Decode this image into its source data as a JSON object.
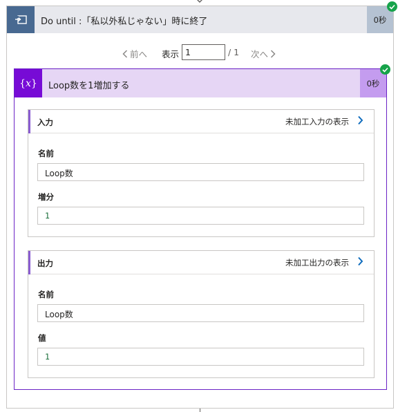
{
  "loop": {
    "title": "Do until :「私以外私じゃない」時に終了",
    "duration": "0秒",
    "icon": "loop-icon",
    "status": "success-check-icon"
  },
  "pager": {
    "prev_label": "前へ",
    "show_label": "表示",
    "page_value": "1",
    "total": "/ 1",
    "next_label": "次へ"
  },
  "action": {
    "title": "Loop数を1増加する",
    "duration": "0秒",
    "icon_text": "{𝑥}",
    "status": "success-check-icon"
  },
  "inputs": {
    "title": "入力",
    "raw_link": "未加工入力の表示",
    "fields": [
      {
        "label": "名前",
        "value": "Loop数"
      },
      {
        "label": "増分",
        "value": "1"
      }
    ]
  },
  "outputs": {
    "title": "出力",
    "raw_link": "未加工出力の表示",
    "fields": [
      {
        "label": "名前",
        "value": "Loop数"
      },
      {
        "label": "値",
        "value": "1"
      }
    ]
  },
  "colors": {
    "loop_icon_bg": "#486991",
    "action_accent": "#770bd6",
    "link_blue": "#0f6cbd",
    "success": "#16a34a"
  }
}
